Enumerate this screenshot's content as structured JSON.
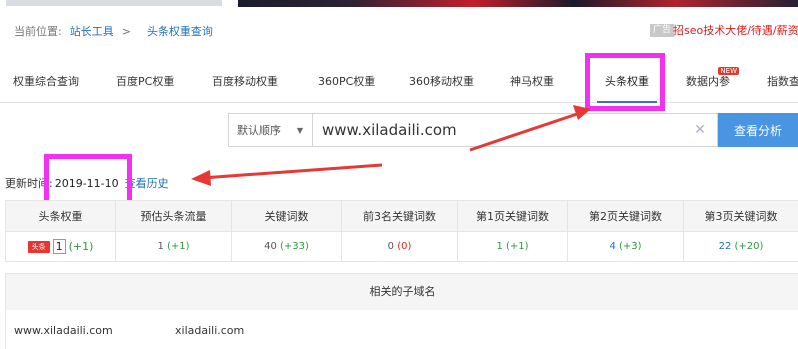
{
  "breadcrumb": {
    "label": "当前位置:",
    "home": "站长工具",
    "separator": ">",
    "current": "头条权重查询"
  },
  "ad": {
    "tag": "广告",
    "text": "招seo技术大佬/待遇/薪资由你"
  },
  "tabs": [
    {
      "label": "权重综合查询"
    },
    {
      "label": "百度PC权重"
    },
    {
      "label": "百度移动权重"
    },
    {
      "label": "360PC权重"
    },
    {
      "label": "360移动权重"
    },
    {
      "label": "神马权重"
    },
    {
      "label": "头条权重",
      "active": true
    },
    {
      "label": "数据内参",
      "badge": "NEW"
    },
    {
      "label": "指数查"
    }
  ],
  "search": {
    "sort_label": "默认顺序",
    "query": "www.xiladaili.com",
    "button": "查看分析"
  },
  "update": {
    "label": "更新时间:",
    "date": "2019-11-10",
    "history_link": "查看历史"
  },
  "stats": {
    "headers": [
      "头条权重",
      "预估头条流量",
      "关键词数",
      "前3名关键词数",
      "第1页关键词数",
      "第2页关键词数",
      "第3页关键词数"
    ],
    "rank_logo": "头条",
    "rank": "1",
    "rank_change": "(+1)",
    "cells": [
      {
        "value": "1",
        "change": "(+1)"
      },
      {
        "value": "40",
        "change": "(+33)"
      },
      {
        "value": "0",
        "change": "(0)"
      },
      {
        "value": "1",
        "change": "(+1)"
      },
      {
        "value": "4",
        "change": "(+3)"
      },
      {
        "value": "22",
        "change": "(+20)"
      }
    ]
  },
  "subdomains": {
    "header": "相关的子域名",
    "items": [
      "www.xiladaili.com",
      "xiladaili.com"
    ]
  },
  "colors": {
    "highlight": "#f230f2",
    "arrow": "#e53935",
    "primary_button": "#4a95e2",
    "link": "#1e72b8"
  }
}
